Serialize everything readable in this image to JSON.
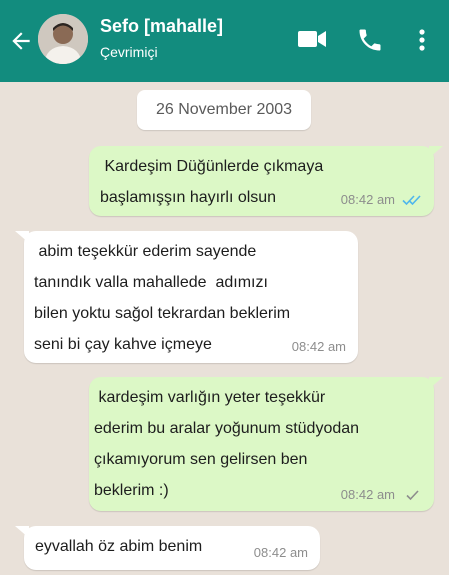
{
  "header": {
    "contact_name": "Sefo [mahalle]",
    "status": "Çevrimiçi",
    "icons": [
      "back-arrow-icon",
      "video-call-icon",
      "voice-call-icon",
      "menu-icon"
    ],
    "color": "#128c7e"
  },
  "chat": {
    "date": "26 November 2003",
    "wallpaper_color": "#e9e1d9",
    "outgoing_color": "#dcf8c6",
    "incoming_color": "#ffffff",
    "messages": [
      {
        "direction": "out",
        "text": " Kardeşim Düğünlerde çıkmaya\nbaşlamışşın hayırlı olsun",
        "time": "08:42 am",
        "status": "read"
      },
      {
        "direction": "in",
        "text": " abim teşekkür ederim sayende\ntanındık valla mahallede  adımızı\nbilen yoktu sağol tekrardan beklerim\nseni bi çay kahve içmeye",
        "time": "08:42 am"
      },
      {
        "direction": "out",
        "text": " kardeşim varlığın yeter teşekkür\nederim bu aralar yoğunum stüdyodan\nçıkamıyorum sen gelirsen ben\nbeklerim :)",
        "time": "08:42 am",
        "status": "sent"
      },
      {
        "direction": "in",
        "text": "eyvallah öz abim benim",
        "time": "08:42 am"
      }
    ]
  }
}
